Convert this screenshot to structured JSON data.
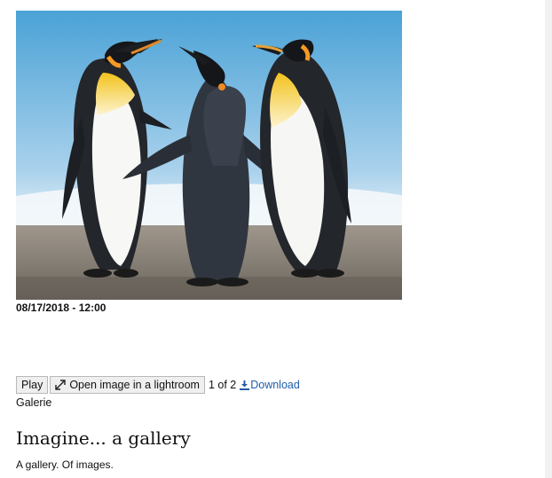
{
  "image": {
    "alt_name": "penguins-image"
  },
  "meta": {
    "date": "08/17/2018 - 12:00"
  },
  "controls": {
    "play_label": "Play",
    "lightroom_label": "Open image in a lightroom",
    "counter": "1 of 2",
    "download_label": "Download"
  },
  "gallery": {
    "label": "Galerie"
  },
  "content": {
    "title": "Imagine... a gallery",
    "description": "A gallery. Of images."
  },
  "icons": {
    "expand": "expand-arrows-icon",
    "download": "download-icon"
  },
  "colors": {
    "link": "#1f5ea8",
    "button_bg": "#efefef",
    "button_border": "#b8b8b8"
  }
}
